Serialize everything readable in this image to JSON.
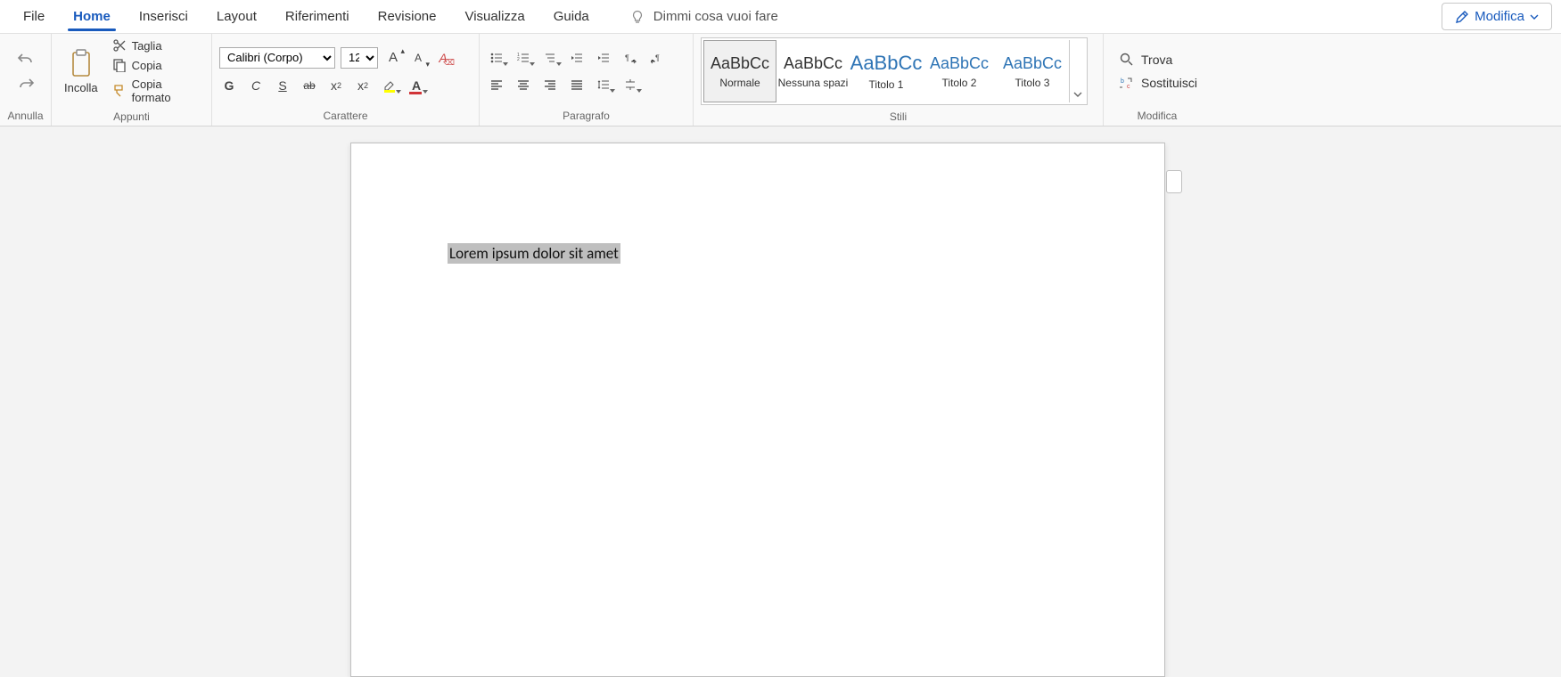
{
  "tabs": {
    "file": "File",
    "home": "Home",
    "insert": "Inserisci",
    "layout": "Layout",
    "references": "Riferimenti",
    "review": "Revisione",
    "view": "Visualizza",
    "help": "Guida"
  },
  "tell_me": "Dimmi cosa vuoi fare",
  "mode_button": "Modifica",
  "groups": {
    "undo": "Annulla",
    "clipboard": "Appunti",
    "font": "Carattere",
    "paragraph": "Paragrafo",
    "styles": "Stili",
    "editing": "Modifica"
  },
  "clipboard": {
    "paste": "Incolla",
    "cut": "Taglia",
    "copy": "Copia",
    "format_painter": "Copia formato"
  },
  "font": {
    "name": "Calibri (Corpo)",
    "size": "12",
    "bold": "G",
    "italic": "C",
    "underline": "S",
    "strike": "ab",
    "subscript": "x",
    "superscript": "x",
    "increase": "A",
    "decrease": "A",
    "clear": "A"
  },
  "styles": [
    {
      "sample": "AaBbCc",
      "name": "Normale",
      "blue": false
    },
    {
      "sample": "AaBbCc",
      "name": "Nessuna spazi",
      "blue": false
    },
    {
      "sample": "AaBbCc",
      "name": "Titolo 1",
      "blue": true
    },
    {
      "sample": "AaBbCc",
      "name": "Titolo 2",
      "blue": true
    },
    {
      "sample": "AaBbCc",
      "name": "Titolo 3",
      "blue": true
    }
  ],
  "editing": {
    "find": "Trova",
    "replace": "Sostituisci"
  },
  "document": {
    "selected_text": "Lorem ipsum dolor sit amet"
  }
}
